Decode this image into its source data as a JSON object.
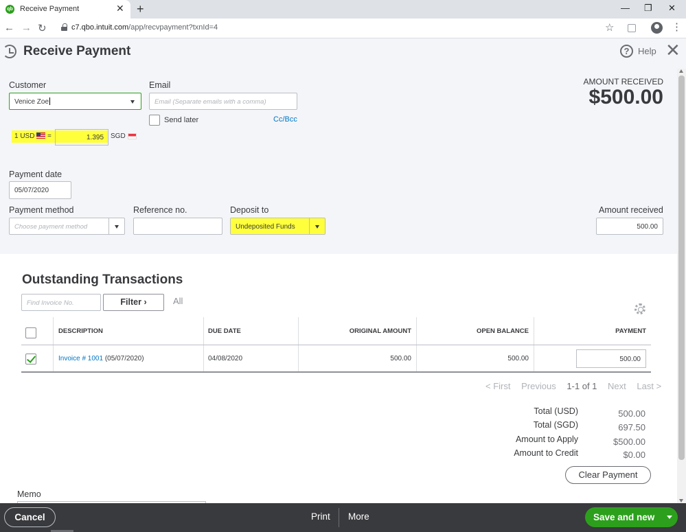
{
  "browser": {
    "tab_title": "Receive Payment",
    "favicon_text": "qb",
    "url_host": "c7.qbo.intuit.com",
    "url_path": "/app/recvpayment?txnId=4"
  },
  "header": {
    "title": "Receive Payment",
    "help_label": "Help"
  },
  "form": {
    "customer_label": "Customer",
    "customer_value": "Venice Zoe",
    "email_label": "Email",
    "email_placeholder": "Email (Separate emails with a comma)",
    "send_later_label": "Send later",
    "ccbcc_label": "Cc/Bcc",
    "exchange_left": "1 USD",
    "exchange_eq": "=",
    "exchange_rate": "1.395",
    "exchange_right": "SGD",
    "payment_date_label": "Payment date",
    "payment_date_value": "05/07/2020",
    "payment_method_label": "Payment method",
    "payment_method_placeholder": "Choose payment method",
    "reference_label": "Reference no.",
    "reference_value": "",
    "deposit_label": "Deposit to",
    "deposit_value": "Undeposited Funds",
    "amount_received_field_label": "Amount received",
    "amount_received_field_value": "500.00"
  },
  "summary": {
    "amount_received_label": "AMOUNT RECEIVED",
    "amount_received_value": "$500.00"
  },
  "transactions": {
    "title": "Outstanding Transactions",
    "find_placeholder": "Find Invoice No.",
    "filter_label": "Filter",
    "all_label": "All",
    "columns": [
      "DESCRIPTION",
      "DUE DATE",
      "ORIGINAL AMOUNT",
      "OPEN BALANCE",
      "PAYMENT"
    ],
    "rows": [
      {
        "invoice_link": "Invoice # 1001",
        "invoice_date": "(05/07/2020)",
        "due_date": "04/08/2020",
        "original_amount": "500.00",
        "open_balance": "500.00",
        "payment": "500.00",
        "checked": true
      }
    ],
    "pager": {
      "first": "< First",
      "previous": "Previous",
      "range": "1-1 of 1",
      "next": "Next",
      "last": "Last >"
    }
  },
  "totals": {
    "total_usd_label": "Total (USD)",
    "total_usd_value": "500.00",
    "total_sgd_label": "Total (SGD)",
    "total_sgd_value": "697.50",
    "amount_to_apply_label": "Amount to Apply",
    "amount_to_apply_value": "$500.00",
    "amount_to_credit_label": "Amount to Credit",
    "amount_to_credit_value": "$0.00",
    "clear_payment_label": "Clear Payment"
  },
  "memo": {
    "label": "Memo"
  },
  "footer": {
    "cancel_label": "Cancel",
    "print_label": "Print",
    "more_label": "More",
    "save_label": "Save and new"
  },
  "colors": {
    "brand_green": "#2ca01c",
    "link_blue": "#0077c5",
    "highlight_yellow": "#ffff3c",
    "footer_bg": "#393a3d"
  }
}
